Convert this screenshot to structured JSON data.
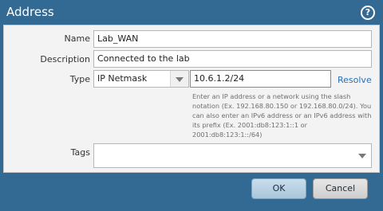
{
  "window": {
    "title": "Address",
    "help_icon": "help-circle-icon"
  },
  "form": {
    "name": {
      "label": "Name",
      "value": "Lab_WAN"
    },
    "description": {
      "label": "Description",
      "value": "Connected to the lab"
    },
    "type": {
      "label": "Type",
      "select_value": "IP Netmask",
      "address_value": "10.6.1.2/24",
      "resolve_label": "Resolve",
      "hint_lines": [
        "Enter an IP address or a network using the slash",
        "notation (Ex. 192.168.80.150 or 192.168.80.0/24). You",
        "can also enter an IPv6 address or an IPv6 address with",
        "its prefix (Ex. 2001:db8:123:1::1 or",
        "2001:db8:123:1::/64)"
      ]
    },
    "tags": {
      "label": "Tags",
      "value": ""
    }
  },
  "footer": {
    "ok_label": "OK",
    "cancel_label": "Cancel"
  },
  "colors": {
    "title_bar": "#336a93",
    "panel": "#f3f3f3",
    "link": "#2a6fb2"
  }
}
